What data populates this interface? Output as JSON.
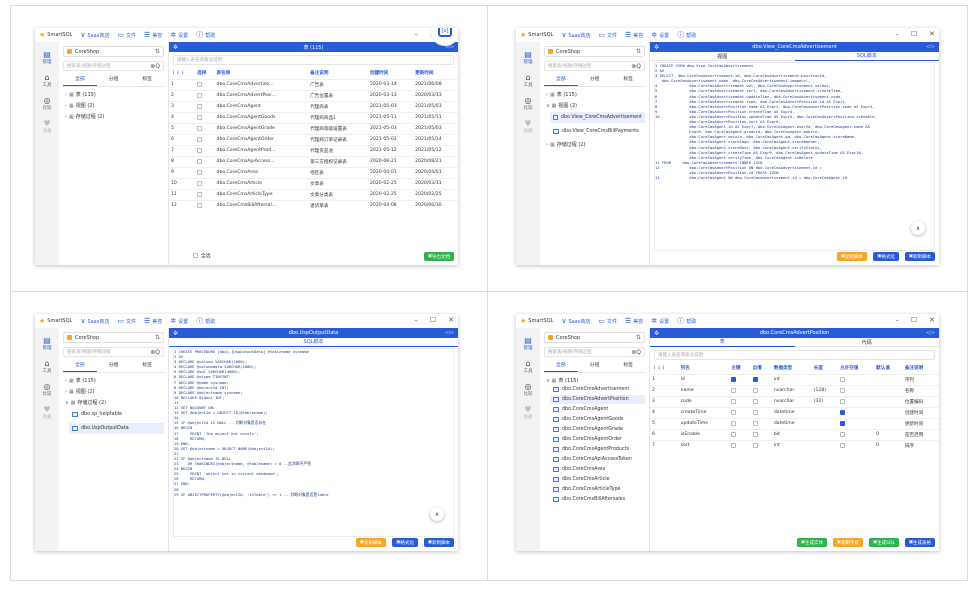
{
  "app": {
    "name": "SmartSQL"
  },
  "menu": {
    "saas": "Saas商店",
    "file": "文件",
    "theme": "美容",
    "settings": "设置",
    "help": "帮助"
  },
  "sidebar": {
    "manage": "管理",
    "tools": "工具",
    "compare": "比较",
    "favorites": "收藏"
  },
  "db": {
    "name": "CoreShop"
  },
  "tree": {
    "search_placeholder": "搜索表/视图/存储过程",
    "tab_all": "全部",
    "tab_group": "分组",
    "tab_tag": "标签",
    "tables": "表 (115)",
    "views": "视图 (2)",
    "procs": "存储过程 (2)"
  },
  "panel1": {
    "header": "表 (115)",
    "filter_placeholder": "请输入表名或备注说明",
    "cols": [
      "",
      "选择",
      "表名称",
      "备注说明",
      "创建时间",
      "更新时间"
    ],
    "rows": [
      [
        "1",
        "dbo.CoreCmsAdvertise...",
        "广告表",
        "2020-03-14",
        "2021/06/08"
      ],
      [
        "2",
        "dbo.CoreCmsAdvertPosi...",
        "广告位置表",
        "2020-03-13",
        "2020/03/13"
      ],
      [
        "3",
        "dbo.CoreCmsAgent",
        "代理商表",
        "2021-05-03",
        "2021/05/03"
      ],
      [
        "4",
        "dbo.CoreCmsAgentGoods",
        "代理商商品1",
        "2021-05-11",
        "2021/05/11"
      ],
      [
        "5",
        "dbo.CoreCmsAgentGrade",
        "代理商等级设置表",
        "2021-05-03",
        "2021/05/03"
      ],
      [
        "6",
        "dbo.CoreCmsAgentOrder",
        "代理商订单记录表",
        "2021-05-03",
        "2021/05/14"
      ],
      [
        "7",
        "dbo.CoreCmsAgentProd...",
        "代理货品池",
        "2021-05-12",
        "2021/05/12"
      ],
      [
        "8",
        "dbo.CoreCmsApiAccess...",
        "第三方授权记录表",
        "2020-08-21",
        "2020/08/21"
      ],
      [
        "9",
        "dbo.CoreCmsArea",
        "地区表",
        "2020-04-01",
        "2020/04/01"
      ],
      [
        "10",
        "dbo.CoreCmsArticle",
        "文章表",
        "2020-02-25",
        "2020/03/11"
      ],
      [
        "11",
        "dbo.CoreCmsArticleType",
        "文章分类表",
        "2020-02-25",
        "2020/02/25"
      ],
      [
        "12",
        "dbo.CoreCmsBillAftersal...",
        "退货单表",
        "2020-04-08",
        "2020/06/30"
      ]
    ],
    "select_all": "全选",
    "export": "导出文档"
  },
  "panel2": {
    "header": "dbo.View_CoreCmsAdvertisement",
    "tab_view": "视图",
    "tab_sql": "SQL脚本",
    "leaves": [
      "dbo.View_CoreCmsAdvertisement",
      "dbo.View_CoreCmsBillPayments"
    ],
    "code": "1 CREATE VIEW dbo.View_CoreCmsAdvertisement\n2 AS\n3 SELECT  dbo.CoreCmsAdvertisement.id, dbo.CoreCmsAdvertisement.positionId,\n   dbo.CoreCmsAdvertisement.name, dbo.CoreCmsAdvertisement.imageUrl,\n4              dbo.CoreCmsAdvertisement.val, dbo.CoreCmsAdvertisement.valDes,\n5              dbo.CoreCmsAdvertisement.sort, dbo.CoreCmsAdvertisement.createTime,\n6              dbo.CoreCmsAdvertisement.updateTime, dbo.CoreCmsAdvertisement.code,\n7              dbo.CoreCmsAdvertisement.type, dbo.CoreCmsAdvertPosition.id AS Expr1,\n8              dbo.CoreCmsAdvertPosition.name AS Expr2, dbo.CoreCmsAdvertPosition.code AS Expr3,\n9              dbo.CoreCmsAdvertPosition.createTime AS Expr4,\n10             dbo.CoreCmsAdvertPosition.updateTime AS Expr5, dbo.CoreCmsAdvertPosition.isEnable,\n               dbo.CoreCmsAdvertPosition.sort AS Expr6,\n               dbo.CoreCmsAgent.id AS Expr7, dbo.CoreCmsAgent.userId, dbo.CoreCmsAgent.name AS\n               Expr8, dbo.CoreCmsAgent.gradeId, dbo.CoreCmsAgent.mobile,\n               dbo.CoreCmsAgent.weixin, dbo.CoreCmsAgent.qq, dbo.CoreCmsAgent.storeName,\n               dbo.CoreCmsAgent.storeLogo, dbo.CoreCmsAgent.storeBanner,\n               dbo.CoreCmsAgent.storeDesc, dbo.CoreCmsAgent.verifyStatus,\n               dbo.CoreCmsAgent.createTime AS Expr9, dbo.CoreCmsAgent.updateTime AS Expr10,\n               dbo.CoreCmsAgent.verifyTime, dbo.CoreCmsAgent.isDelete\n11 FROM     dbo.CoreCmsAdvertisement INNER JOIN\n12             dbo.CoreCmsAdvertPosition ON dbo.CoreCmsAdvertisement.id =\n               dbo.CoreCmsAdvertPosition.id CROSS JOIN\n13             dbo.CoreCmsAgent ON dbo.CoreCmsAdvertisement.id = dbo.CoreCmsAgent.id",
    "btn_copy": "复制脚本",
    "btn_format": "格式化",
    "btn_new": "新制脚本"
  },
  "panel3": {
    "header": "dbo.UspOutputData",
    "tab_sql": "SQL脚本",
    "leaves": [
      "dbo.sp_helptable",
      "dbo.UspOutputData"
    ],
    "code": "1 CREATE PROCEDURE [dbo].[UspOutputData] @tablename sysname\n2 AS\n3 DECLARE @column VARCHAR(1000);\n4 DECLARE @columndata VARCHAR(1000);\n5 DECLARE @sql VARCHAR(4000);\n6 DECLARE @xtype TINYINT;\n7 DECLARE @name sysname;\n8 DECLARE @objectId INT;\n9 DECLARE @objectname sysname;\n10 DECLARE @ident INT;\n11\n12 SET NOCOUNT ON;\n13 SET @objectId = OBJECT_ID(@tablename);\n14\n15 IF @objectId IS NULL -- 判断对象是否存在\n16 BEGIN\n17     PRINT 'The object not exists';\n18     RETURN;\n19 END;\n20 SET @objectname = OBJECT_NAME(@objectId);\n21\n22 IF @objectname IS NULL\n23    OR CHARINDEX(@objectname, @tablename) = 0 --此判断不严密\n24 BEGIN\n25     PRINT 'object not in current database';\n26     RETURN;\n27 END;\n28\n29 IF OBJECTPROPERTY(@objectId, 'IsTable') <> 1 -- 判断对象是否是table",
    "btn_copy": "复制脚本",
    "btn_format": "格式化",
    "btn_new": "新制脚本"
  },
  "panel4": {
    "header": "dbo.CoreCmsAdvertPosition",
    "tab_table": "表",
    "tab_code": "代码",
    "filter_placeholder": "请输入表名或备注说明",
    "leaves": [
      "dbo.CoreCmsAdvertisement",
      "dbo.CoreCmsAdvertPosition",
      "dbo.CoreCmsAgent",
      "dbo.CoreCmsAgentGoods",
      "dbo.CoreCmsAgentGrade",
      "dbo.CoreCmsAgentOrder",
      "dbo.CoreCmsAgentProducts",
      "dbo.CoreCmsApiAccessToken",
      "dbo.CoreCmsArea",
      "dbo.CoreCmsArticle",
      "dbo.CoreCmsArticleType",
      "dbo.CoreCmsBillAftersales"
    ],
    "cols": [
      "",
      "列名",
      "主键",
      "自增",
      "数据类型",
      "长度",
      "允许空值",
      "默认值",
      "备注说明"
    ],
    "rows": [
      [
        "1",
        "id",
        true,
        true,
        "int",
        "",
        false,
        "",
        "序列"
      ],
      [
        "2",
        "name",
        false,
        false,
        "nvarchar",
        "(128)",
        false,
        "",
        "名称"
      ],
      [
        "3",
        "code",
        false,
        false,
        "nvarchar",
        "(32)",
        false,
        "",
        "位置编码"
      ],
      [
        "4",
        "createTime",
        false,
        false,
        "datetime",
        "",
        true,
        "",
        "创建时间"
      ],
      [
        "5",
        "updateTime",
        false,
        false,
        "datetime",
        "",
        true,
        "",
        "更新时间"
      ],
      [
        "6",
        "isEnable",
        false,
        false,
        "bit",
        "",
        false,
        "0",
        "是否启用"
      ],
      [
        "7",
        "sort",
        false,
        false,
        "int",
        "",
        false,
        "0",
        "排序"
      ]
    ],
    "btn_entity": "生成实体",
    "btn_copy": "复制字段",
    "btn_sql": "生成SQL",
    "btn_table": "生成表格"
  },
  "colors": {
    "accent": "#2a5bd7",
    "orange": "#f5a623",
    "green": "#2cb34a"
  }
}
